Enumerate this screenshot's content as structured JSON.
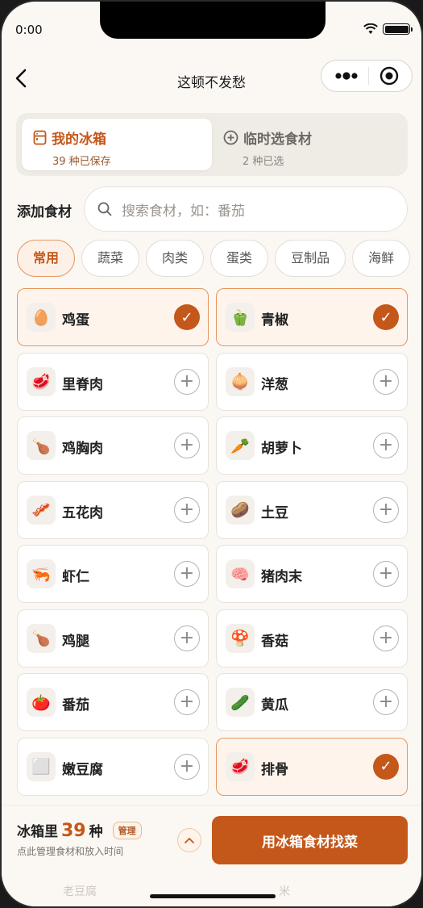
{
  "status_bar": {
    "time": "0:00"
  },
  "nav": {
    "title": "这顿不发愁"
  },
  "tabs": [
    {
      "title": "我的冰箱",
      "sub": "39 种已保存"
    },
    {
      "title": "临时选食材",
      "sub": "2 种已选"
    }
  ],
  "add": {
    "label": "添加食材",
    "search_placeholder": "搜索食材，如：番茄"
  },
  "categories": [
    "常用",
    "蔬菜",
    "肉类",
    "蛋类",
    "豆制品",
    "海鲜"
  ],
  "ingredients": [
    {
      "name": "鸡蛋",
      "icon": "🥚",
      "icon_name": "egg-icon",
      "selected": true
    },
    {
      "name": "青椒",
      "icon": "🫑",
      "icon_name": "green-pepper-icon",
      "selected": true
    },
    {
      "name": "里脊肉",
      "icon": "🥩",
      "icon_name": "meat-icon",
      "selected": false
    },
    {
      "name": "洋葱",
      "icon": "🧅",
      "icon_name": "onion-icon",
      "selected": false
    },
    {
      "name": "鸡胸肉",
      "icon": "🍗",
      "icon_name": "chicken-breast-icon",
      "selected": false
    },
    {
      "name": "胡萝卜",
      "icon": "🥕",
      "icon_name": "carrot-icon",
      "selected": false
    },
    {
      "name": "五花肉",
      "icon": "🥓",
      "icon_name": "pork-belly-icon",
      "selected": false
    },
    {
      "name": "土豆",
      "icon": "🥔",
      "icon_name": "potato-icon",
      "selected": false
    },
    {
      "name": "虾仁",
      "icon": "🦐",
      "icon_name": "shrimp-icon",
      "selected": false
    },
    {
      "name": "猪肉末",
      "icon": "🧠",
      "icon_name": "minced-pork-icon",
      "selected": false
    },
    {
      "name": "鸡腿",
      "icon": "🍗",
      "icon_name": "drumstick-icon",
      "selected": false
    },
    {
      "name": "香菇",
      "icon": "🍄",
      "icon_name": "mushroom-icon",
      "selected": false
    },
    {
      "name": "番茄",
      "icon": "🍅",
      "icon_name": "tomato-icon",
      "selected": false
    },
    {
      "name": "黄瓜",
      "icon": "🥒",
      "icon_name": "cucumber-icon",
      "selected": false
    },
    {
      "name": "嫩豆腐",
      "icon": "⬜",
      "icon_name": "tofu-icon",
      "selected": false
    },
    {
      "name": "排骨",
      "icon": "🥩",
      "icon_name": "ribs-icon",
      "selected": true
    }
  ],
  "bottom": {
    "fridge_prefix": "冰箱里",
    "fridge_count": "39",
    "fridge_unit": "种",
    "manage_label": "管理",
    "hint": "点此管理食材和放入时间",
    "cta_label": "用冰箱食材找菜",
    "ghost_left": "老豆腐",
    "ghost_right": "米"
  },
  "colors": {
    "accent": "#c4571a",
    "background": "#fbf8f4"
  }
}
